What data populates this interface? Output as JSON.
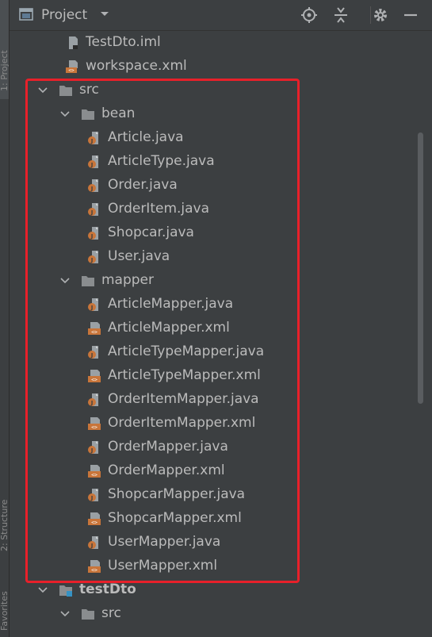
{
  "header": {
    "title": "Project"
  },
  "side_tabs": [
    {
      "label": "1: Project"
    },
    {
      "label": "2: Structure"
    },
    {
      "label": "Favorites"
    }
  ],
  "icons": {
    "header": [
      "project-window-icon",
      "dropdown-caret-icon",
      "locate-icon",
      "collapse-all-icon",
      "settings-icon",
      "hide-icon"
    ],
    "folder_color": "#8a8d8f",
    "java_color": "#c8753a",
    "xml_color": "#c8753a",
    "highlight_color": "#e8202a"
  },
  "tree": [
    {
      "label": "TestDto.iml",
      "type": "iml",
      "indent": 3,
      "expanded": null
    },
    {
      "label": "workspace.xml",
      "type": "xml-plain",
      "indent": 3,
      "expanded": null
    },
    {
      "label": "src",
      "type": "folder",
      "indent": 1,
      "expanded": true
    },
    {
      "label": "bean",
      "type": "folder",
      "indent": 2,
      "expanded": true
    },
    {
      "label": "Article.java",
      "type": "java",
      "indent": 4,
      "expanded": null
    },
    {
      "label": "ArticleType.java",
      "type": "java",
      "indent": 4,
      "expanded": null
    },
    {
      "label": "Order.java",
      "type": "java",
      "indent": 4,
      "expanded": null
    },
    {
      "label": "OrderItem.java",
      "type": "java",
      "indent": 4,
      "expanded": null
    },
    {
      "label": "Shopcar.java",
      "type": "java",
      "indent": 4,
      "expanded": null
    },
    {
      "label": "User.java",
      "type": "java",
      "indent": 4,
      "expanded": null
    },
    {
      "label": "mapper",
      "type": "folder",
      "indent": 2,
      "expanded": true
    },
    {
      "label": "ArticleMapper.java",
      "type": "java",
      "indent": 4,
      "expanded": null
    },
    {
      "label": "ArticleMapper.xml",
      "type": "xml",
      "indent": 4,
      "expanded": null
    },
    {
      "label": "ArticleTypeMapper.java",
      "type": "java",
      "indent": 4,
      "expanded": null
    },
    {
      "label": "ArticleTypeMapper.xml",
      "type": "xml",
      "indent": 4,
      "expanded": null
    },
    {
      "label": "OrderItemMapper.java",
      "type": "java",
      "indent": 4,
      "expanded": null
    },
    {
      "label": "OrderItemMapper.xml",
      "type": "xml",
      "indent": 4,
      "expanded": null
    },
    {
      "label": "OrderMapper.java",
      "type": "java",
      "indent": 4,
      "expanded": null
    },
    {
      "label": "OrderMapper.xml",
      "type": "xml",
      "indent": 4,
      "expanded": null
    },
    {
      "label": "ShopcarMapper.java",
      "type": "java",
      "indent": 4,
      "expanded": null
    },
    {
      "label": "ShopcarMapper.xml",
      "type": "xml",
      "indent": 4,
      "expanded": null
    },
    {
      "label": "UserMapper.java",
      "type": "java",
      "indent": 4,
      "expanded": null
    },
    {
      "label": "UserMapper.xml",
      "type": "xml",
      "indent": 4,
      "expanded": null
    },
    {
      "label": "testDto",
      "type": "module",
      "indent": 1,
      "expanded": true,
      "bold": true
    },
    {
      "label": "src",
      "type": "folder",
      "indent": 2,
      "expanded": true
    }
  ]
}
